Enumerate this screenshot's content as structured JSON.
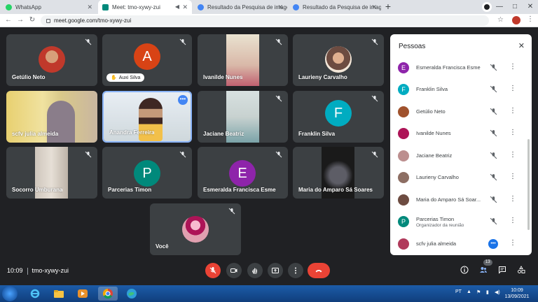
{
  "browser": {
    "tabs": [
      {
        "title": "WhatsApp",
        "favicon_color": "#25d366",
        "active": false
      },
      {
        "title": "Meet: tmo-xywy-zui",
        "favicon_color": "#00897b",
        "active": true
      },
      {
        "title": "Resultado da Pesquisa de image",
        "favicon_color": "#4285f4",
        "active": false
      },
      {
        "title": "Resultado da Pesquisa de image",
        "favicon_color": "#4285f4",
        "active": false
      }
    ],
    "new_tab_icon": "+",
    "url": "meet.google.com/tmo-xywy-zui",
    "window_controls": [
      "—",
      "□",
      "✕"
    ]
  },
  "tiles": [
    {
      "name": "Getúlio Neto",
      "avatar": "photo",
      "avatar_color": "#c0392b",
      "muted": true
    },
    {
      "name": "A",
      "avatar": "letter",
      "avatar_color": "#d84315",
      "muted": true,
      "chip": "Auxi Silva"
    },
    {
      "name": "Ivanilde Nunes",
      "avatar": "video",
      "muted": true
    },
    {
      "name": "Laurieny Carvalho",
      "avatar": "photo",
      "avatar_color": "#8d6e63",
      "muted": true
    },
    {
      "name": "scfv julia almeida",
      "avatar": "video",
      "muted": false
    },
    {
      "name": "Anandra Ferreira",
      "avatar": "video",
      "muted": false,
      "active": true
    },
    {
      "name": "Jaciane Beatriz",
      "avatar": "video",
      "muted": true
    },
    {
      "name": "Franklin Silva",
      "avatar": "letter",
      "letter": "F",
      "avatar_color": "#00acc1",
      "muted": true
    },
    {
      "name": "Socorro Umburana",
      "avatar": "video",
      "muted": true
    },
    {
      "name": "Parcerias Timon",
      "avatar": "letter",
      "letter": "P",
      "avatar_color": "#00897b",
      "muted": true
    },
    {
      "name": "Esmeralda Francisca Esme",
      "avatar": "letter",
      "letter": "E",
      "avatar_color": "#8e24aa",
      "muted": true
    },
    {
      "name": "Maria do Amparo Sá Soares",
      "avatar": "video",
      "muted": true
    },
    {
      "name": "Você",
      "avatar": "photo",
      "avatar_color": "#ad1457",
      "muted": true
    }
  ],
  "people_panel": {
    "title": "Pessoas",
    "people": [
      {
        "name": "Esmeralda Francisca Esme",
        "letter": "E",
        "color": "#8e24aa",
        "muted": true
      },
      {
        "name": "Franklin Silva",
        "letter": "F",
        "color": "#00acc1",
        "muted": true
      },
      {
        "name": "Getúlio Neto",
        "letter": "",
        "color": "#a0522d",
        "muted": true
      },
      {
        "name": "Ivanilde Nunes",
        "letter": "",
        "color": "#ad1457",
        "muted": true
      },
      {
        "name": "Jaciane Beatriz",
        "letter": "",
        "color": "#bc8f8f",
        "muted": true
      },
      {
        "name": "Laurieny Carvalho",
        "letter": "",
        "color": "#8d6e63",
        "muted": true
      },
      {
        "name": "Maria do Amparo Sá Soar...",
        "letter": "",
        "color": "#6d4c41",
        "muted": true
      },
      {
        "name": "Parcerias Timon",
        "role": "Organizador da reunião",
        "letter": "P",
        "color": "#00897b",
        "muted": true
      },
      {
        "name": "scfv julia almeida",
        "letter": "",
        "color": "#b03a5b",
        "muted": false
      }
    ]
  },
  "meeting": {
    "time": "10:09",
    "code": "tmo-xywy-zui",
    "participants_badge": "13"
  },
  "taskbar": {
    "language": "PT",
    "time": "10:09",
    "date": "13/09/2021"
  }
}
